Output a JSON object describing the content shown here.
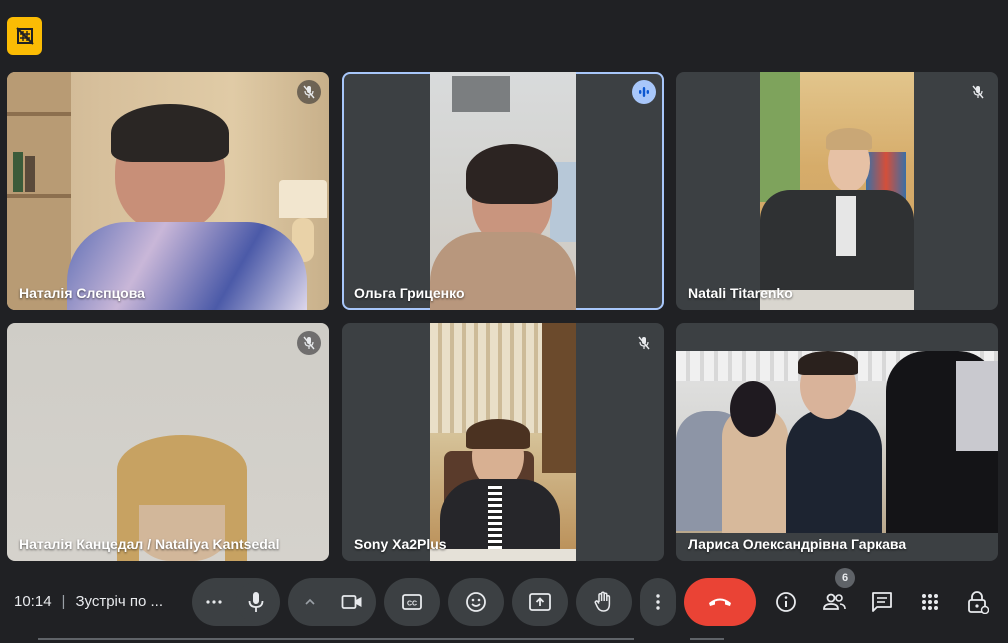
{
  "tiles": [
    {
      "name": "Наталія Слєпцова",
      "state": "muted"
    },
    {
      "name": "Ольга Гриценко",
      "state": "speaking"
    },
    {
      "name": "Natali Titarenko",
      "state": "muted"
    },
    {
      "name": "Наталія Канцедал / Nataliya Kantsedal",
      "state": "muted"
    },
    {
      "name": "Sony Xa2Plus",
      "state": "muted"
    },
    {
      "name": "Лариса Олександрівна Гаркава",
      "state": "none"
    }
  ],
  "bottom_bar": {
    "time": "10:14",
    "separator": "|",
    "meeting_title": "Зустріч по ...",
    "participants_count": "6",
    "end_call_color": "#ea4335"
  },
  "icons": {
    "top_badge": "camera-off-icon",
    "more_mic": "more-horizontal-icon",
    "mic": "mic-icon",
    "cam_chevron": "chevron-up-icon",
    "camera": "videocam-icon",
    "captions": "closed-captions-icon",
    "emoji": "emoji-icon",
    "present": "present-screen-icon",
    "hand": "raise-hand-icon",
    "more": "more-vertical-icon",
    "end_call": "call-end-icon",
    "info": "info-icon",
    "people": "people-icon",
    "chat": "chat-icon",
    "activities": "apps-grid-icon",
    "host": "host-controls-icon"
  },
  "colors": {
    "background": "#202124",
    "tile": "#3c4043",
    "active_border": "#a8c7fa",
    "badge": "#fbbc04"
  }
}
